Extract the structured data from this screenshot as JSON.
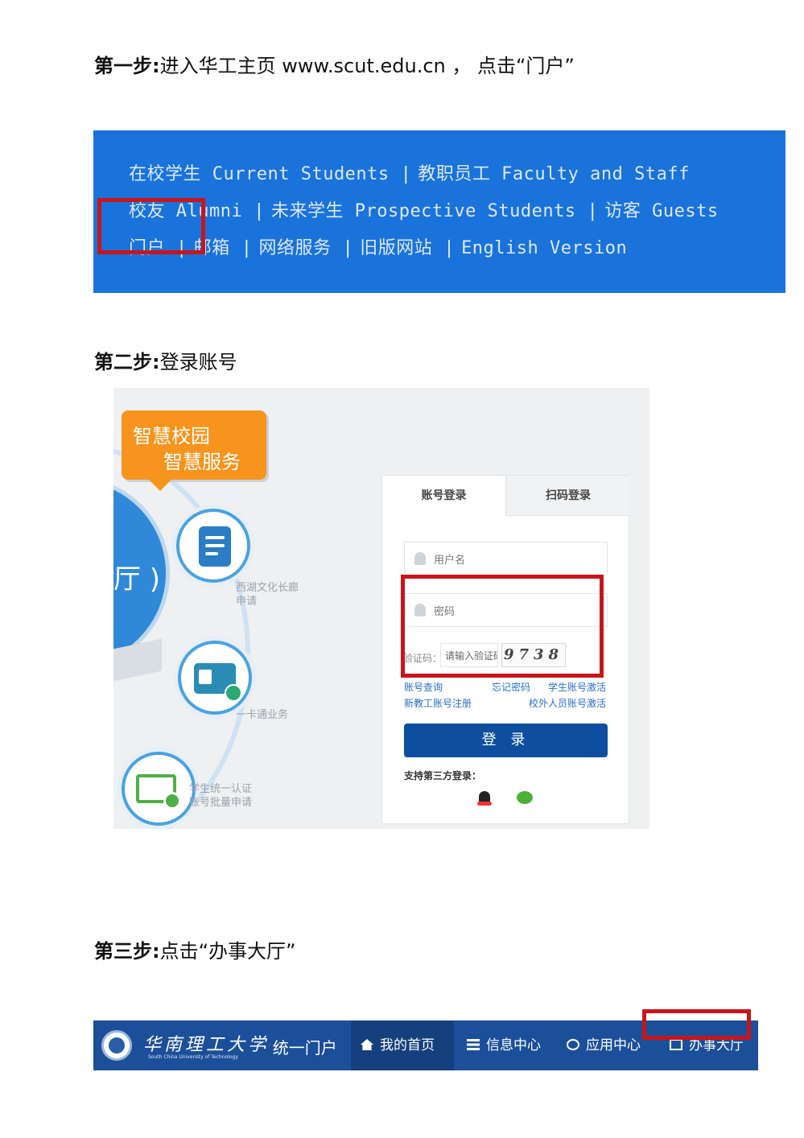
{
  "step1": {
    "label": "第一步:",
    "text": "进入华工主页 www.scut.edu.cn ， 点击“门户”"
  },
  "banner1": {
    "line1": [
      "在校学生 Current Students",
      "|",
      "教职员工 Faculty and Staff"
    ],
    "line2": [
      "校友 Alumni",
      "|",
      "未来学生 Prospective Students",
      "|",
      "访客 Guests"
    ],
    "line3": [
      "门户",
      "|",
      "邮箱",
      "|",
      "网络服务",
      "|",
      "旧版网站",
      "|",
      "English Version"
    ]
  },
  "step2": {
    "label": "第二步:",
    "text": "登录账号"
  },
  "login": {
    "bubble_line1": "智慧校园",
    "bubble_line2": "智慧服务",
    "hall_fragment": "厅 )",
    "services": [
      "西湖文化长廊\n申请",
      "一卡通业务",
      "学生统一认证\n账号批量申请"
    ],
    "tab_account": "账号登录",
    "tab_qr": "扫码登录",
    "username_placeholder": "用户名",
    "password_placeholder": "密码",
    "captcha_label": "验证码：",
    "captcha_placeholder": "请输入验证码",
    "captcha_code": "9738",
    "link_account_query": "账号查询",
    "link_forgot": "忘记密码",
    "link_student_activate": "学生账号激活",
    "link_new_staff": "新教工账号注册",
    "link_external_activate": "校外人员账号激活",
    "login_button": "登 录",
    "third_party": "支持第三方登录："
  },
  "step3": {
    "label": "第三步:",
    "text": "点击“办事大厅”"
  },
  "navbar": {
    "university_cn": "华南理工大学",
    "university_en": "South China University of Technology",
    "portal": "· 统一门户",
    "items": [
      "我的首页",
      "信息中心",
      "应用中心",
      "办事大厅"
    ]
  },
  "colors": {
    "banner_blue": "#1a73db",
    "nav_blue": "#1c4f9a",
    "highlight_red": "#c8151b",
    "bubble_orange": "#f7941d",
    "login_button": "#0d4f9e"
  }
}
